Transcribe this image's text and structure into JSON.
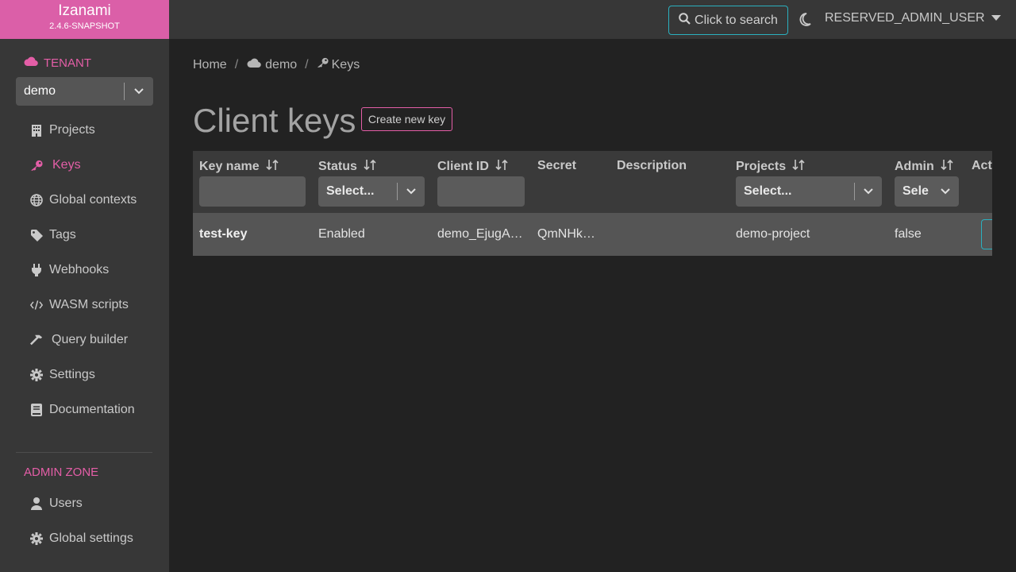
{
  "app": {
    "name": "Izanami",
    "version": "2.4.6-SNAPSHOT"
  },
  "sidebar": {
    "tenant_label": "TENANT",
    "tenant_value": "demo",
    "items": [
      {
        "label": "Projects",
        "icon": "building-icon"
      },
      {
        "label": "Keys",
        "icon": "key-icon",
        "active": true
      },
      {
        "label": "Global contexts",
        "icon": "globe-icon"
      },
      {
        "label": "Tags",
        "icon": "tag-icon"
      },
      {
        "label": "Webhooks",
        "icon": "plug-icon"
      },
      {
        "label": "WASM scripts",
        "icon": "code-icon"
      },
      {
        "label": "Query builder",
        "icon": "hammer-icon"
      },
      {
        "label": "Settings",
        "icon": "gear-icon"
      },
      {
        "label": "Documentation",
        "icon": "book-icon"
      }
    ],
    "admin_label": "ADMIN ZONE",
    "admin_items": [
      {
        "label": "Users",
        "icon": "user-icon"
      },
      {
        "label": "Global settings",
        "icon": "gear-icon"
      }
    ]
  },
  "topbar": {
    "search_label": "Click to search",
    "user": "RESERVED_ADMIN_USER"
  },
  "breadcrumb": {
    "home": "Home",
    "tenant": "demo",
    "page": "Keys"
  },
  "page": {
    "title": "Client keys",
    "create_label": "Create new key"
  },
  "table": {
    "headers": {
      "key_name": "Key name",
      "status": "Status",
      "client_id": "Client ID",
      "secret": "Secret",
      "description": "Description",
      "projects": "Projects",
      "admin": "Admin",
      "actions": "Act"
    },
    "filters": {
      "status_placeholder": "Select...",
      "projects_placeholder": "Select...",
      "admin_placeholder": "Sele"
    },
    "rows": [
      {
        "key_name": "test-key",
        "status": "Enabled",
        "client_id": "demo_EjugA…",
        "secret": "QmNHk…",
        "description": "",
        "projects": "demo-project",
        "admin": "false"
      }
    ]
  },
  "colors": {
    "accent": "#e45ea7",
    "info": "#2ab0bf"
  }
}
